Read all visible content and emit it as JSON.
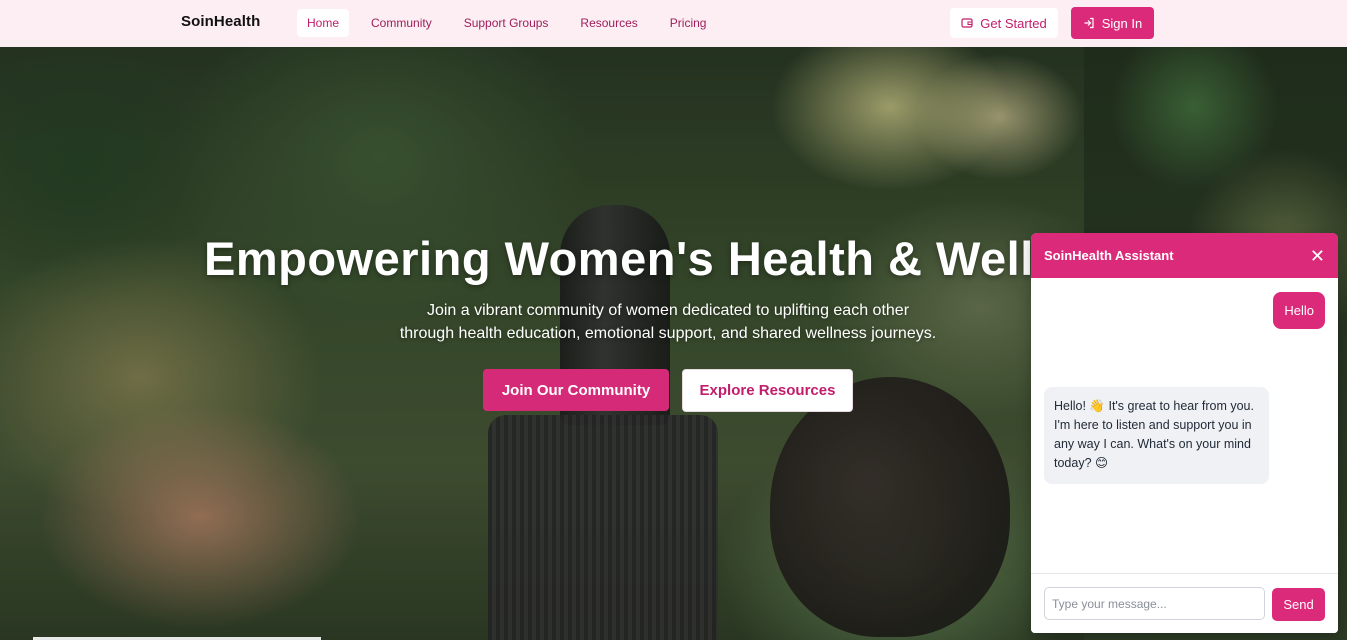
{
  "brand": {
    "name": "SoinHealth"
  },
  "nav": {
    "links": [
      {
        "label": "Home",
        "active": true
      },
      {
        "label": "Community"
      },
      {
        "label": "Support Groups"
      },
      {
        "label": "Resources"
      },
      {
        "label": "Pricing"
      }
    ],
    "get_started": {
      "label": "Get Started",
      "icon": "wallet-icon"
    },
    "sign_in": {
      "label": "Sign In",
      "icon": "login-icon"
    }
  },
  "hero": {
    "title": "Empowering Women's Health & Wellness",
    "subtitle_line1": "Join a vibrant community of women dedicated to uplifting each other",
    "subtitle_line2": "through health education, emotional support, and shared wellness journeys.",
    "primary_button": "Join Our Community",
    "secondary_button": "Explore Resources"
  },
  "chat": {
    "title": "SoinHealth Assistant",
    "close_symbol": "✕",
    "messages": [
      {
        "from": "user",
        "text": "Hello"
      },
      {
        "from": "bot",
        "text": "Hello! 👋 It's great to hear from you. I'm here to listen and support you in any way I can. What's on your mind today? 😊"
      }
    ],
    "input_placeholder": "Type your message...",
    "send_label": "Send"
  },
  "colors": {
    "accent": "#dc2a7b",
    "nav_bg": "#fdeef4",
    "nav_link": "#9c1f5b"
  }
}
